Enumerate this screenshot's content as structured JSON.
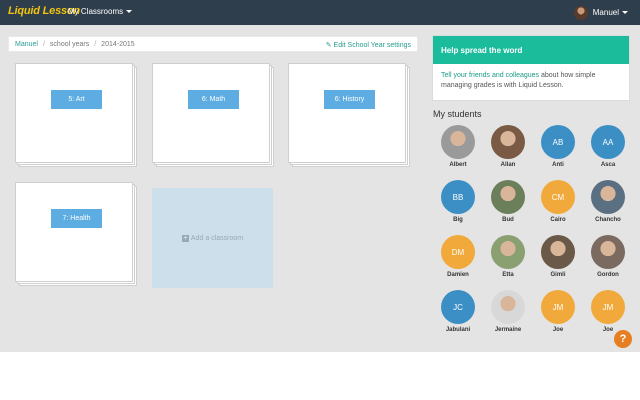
{
  "brand": "Liquid Lesson",
  "nav": {
    "classrooms_label": "My Classrooms",
    "user_name": "Manuel"
  },
  "breadcrumb": {
    "items": [
      "Manuel",
      "school years",
      "2014-2015"
    ],
    "edit_label": "Edit School Year settings"
  },
  "classrooms": [
    {
      "label": "5: Art"
    },
    {
      "label": "6: Math"
    },
    {
      "label": "6: History"
    },
    {
      "label": "7: Health"
    }
  ],
  "add_classroom_label": "Add a classroom",
  "spread": {
    "title": "Help spread the word",
    "link_text": "Tell your friends and colleagues",
    "body_text": " about how simple managing grades is with Liquid Lesson."
  },
  "students_title": "My students",
  "students": [
    {
      "name": "Albert",
      "initials": "",
      "color": "#9a9a9a"
    },
    {
      "name": "Allan",
      "initials": "",
      "color": "#7a5a44"
    },
    {
      "name": "Anti",
      "initials": "AB",
      "color": "#3b8fc4"
    },
    {
      "name": "Asca",
      "initials": "AA",
      "color": "#3b8fc4"
    },
    {
      "name": "Big",
      "initials": "BB",
      "color": "#3b8fc4"
    },
    {
      "name": "Bud",
      "initials": "",
      "color": "#6b7f5a"
    },
    {
      "name": "Cairo",
      "initials": "CM",
      "color": "#f0a93a"
    },
    {
      "name": "Chancho",
      "initials": "",
      "color": "#5a6f82"
    },
    {
      "name": "Damien",
      "initials": "DM",
      "color": "#f0a93a"
    },
    {
      "name": "Etta",
      "initials": "",
      "color": "#8aa070"
    },
    {
      "name": "Gimli",
      "initials": "",
      "color": "#6a5848"
    },
    {
      "name": "Gordon",
      "initials": "",
      "color": "#7a6a60"
    },
    {
      "name": "Jabulani",
      "initials": "JC",
      "color": "#3b8fc4"
    },
    {
      "name": "Jermaine",
      "initials": "",
      "color": "#d8d8d8"
    },
    {
      "name": "Joe",
      "initials": "JM",
      "color": "#f0a93a"
    },
    {
      "name": "Joe",
      "initials": "JM",
      "color": "#f0a93a"
    }
  ],
  "help_label": "?"
}
